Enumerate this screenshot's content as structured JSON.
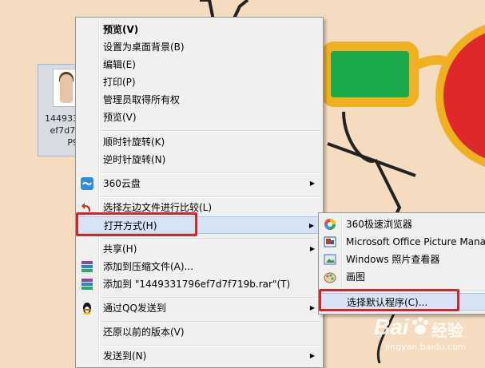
{
  "desktop_file": {
    "name": "144933\nef7d7f\nP9"
  },
  "context_menu": {
    "items": [
      {
        "label": "预览(V)"
      },
      {
        "label": "设置为桌面背景(B)"
      },
      {
        "label": "编辑(E)"
      },
      {
        "label": "打印(P)"
      },
      {
        "label": "管理员取得所有权"
      },
      {
        "label": "预览(V)"
      },
      {
        "label": "顺时针旋转(K)"
      },
      {
        "label": "逆时针旋转(N)"
      },
      {
        "label": "360云盘"
      },
      {
        "label": "选择左边文件进行比较(L)"
      },
      {
        "label": "打开方式(H)"
      },
      {
        "label": "共享(H)"
      },
      {
        "label": "添加到压缩文件(A)..."
      },
      {
        "label": "添加到 \"1449331796ef7d7f719b.rar\"(T)"
      },
      {
        "label": "通过QQ发送到"
      },
      {
        "label": "还原以前的版本(V)"
      },
      {
        "label": "发送到(N)"
      }
    ]
  },
  "open_with_menu": {
    "items": [
      {
        "label": "360极速浏览器"
      },
      {
        "label": "Microsoft Office Picture Mana"
      },
      {
        "label": "Windows 照片查看器"
      },
      {
        "label": "画图"
      },
      {
        "label": "选择默认程序(C)..."
      }
    ]
  },
  "watermark": {
    "brand": "Bai",
    "brand2": "经验",
    "url": "jingyan.baidu.com"
  },
  "colors": {
    "highlight_box": "#d9232b",
    "menu_bg": "#f0f0f0",
    "wallpaper": "#f5dcc0"
  }
}
